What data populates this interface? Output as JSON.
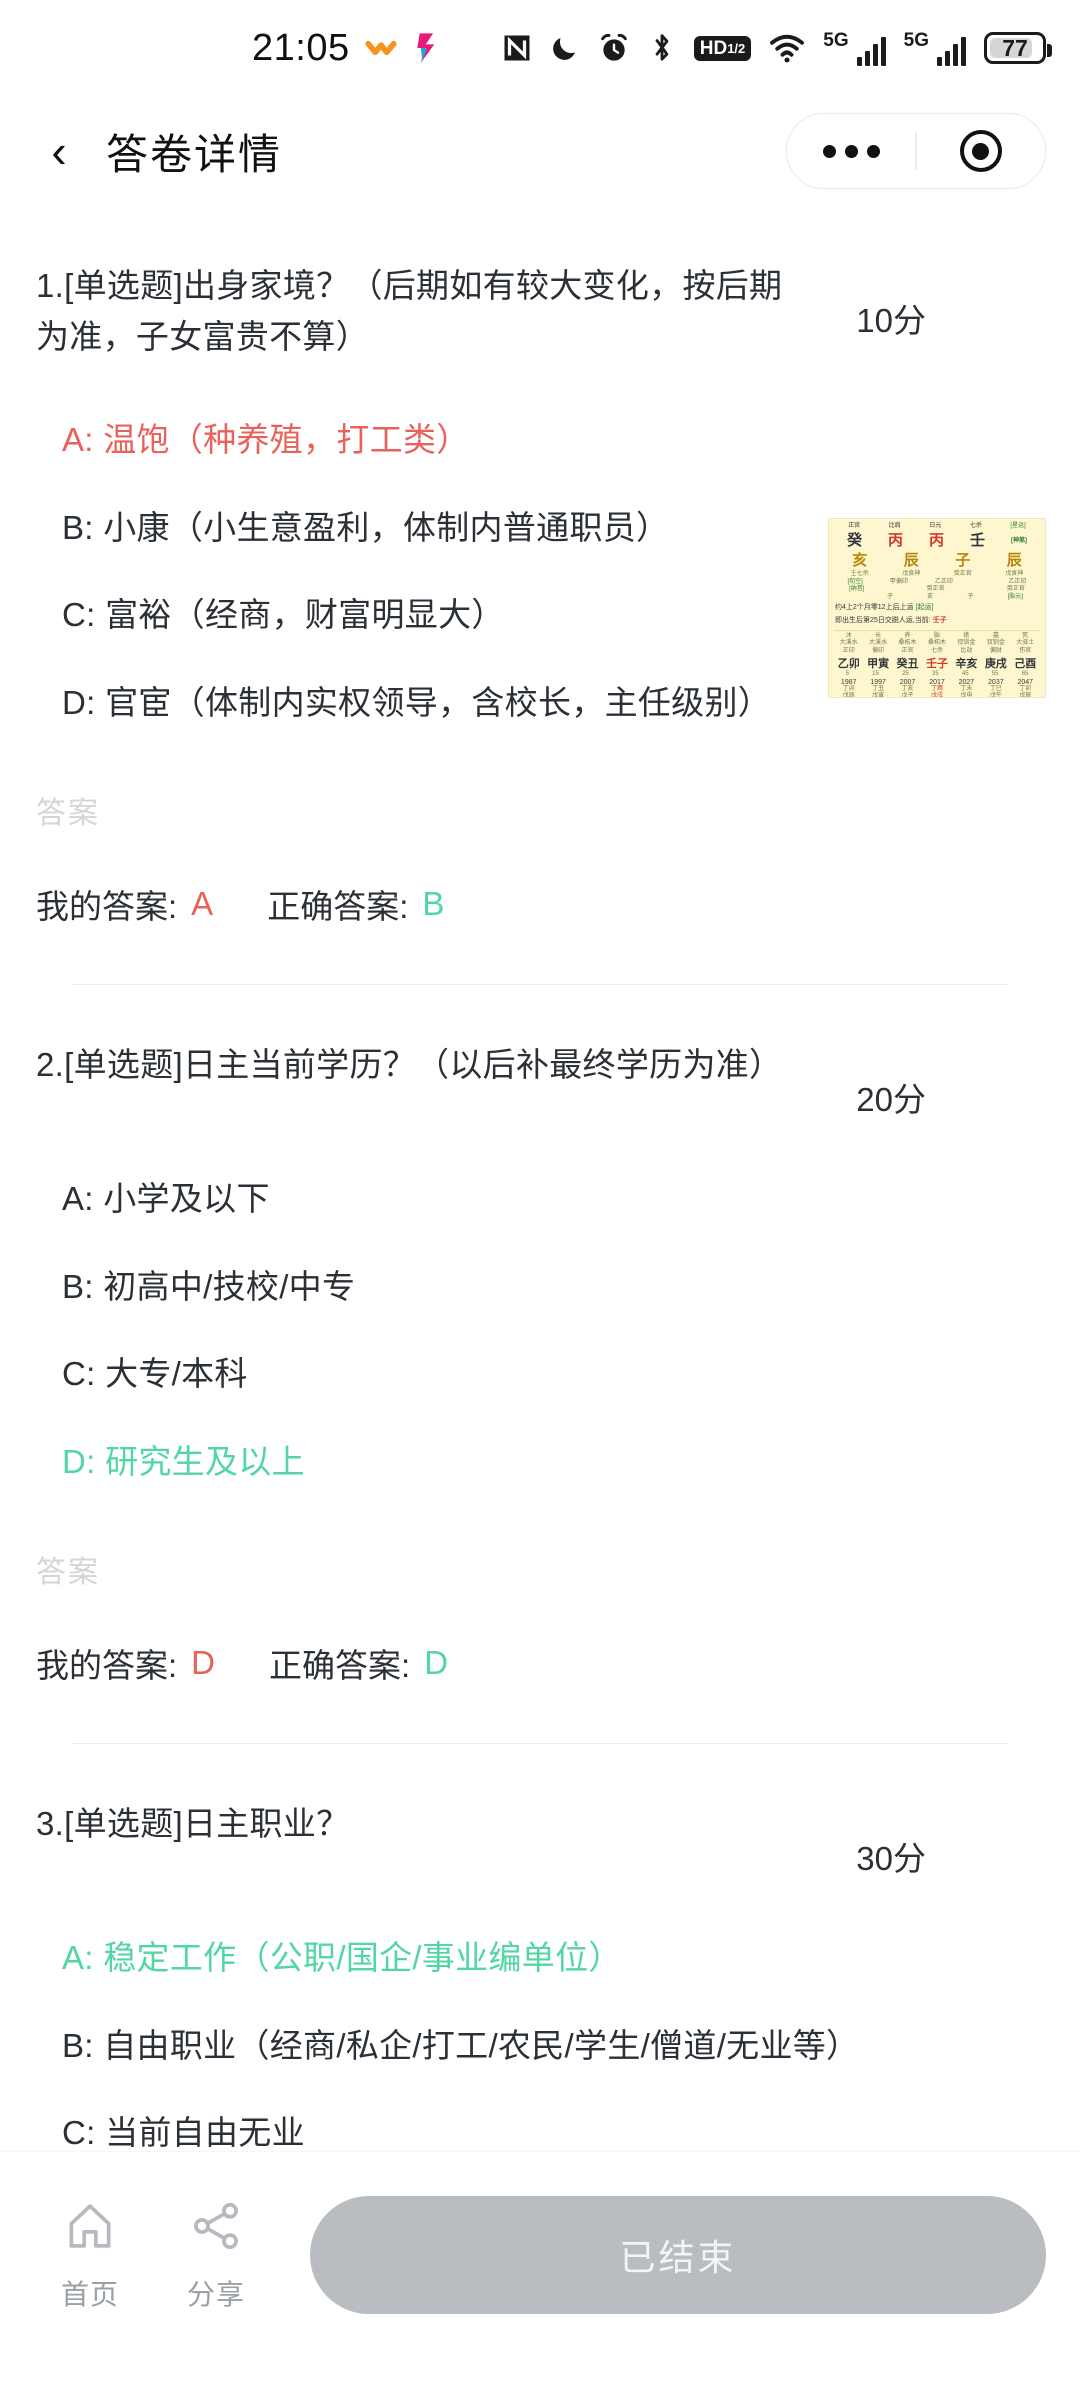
{
  "statusbar": {
    "time": "21:05",
    "app_icons": [
      "heart-orange-icon",
      "music-app-icon"
    ],
    "right_icons": [
      "nfc-icon",
      "do-not-disturb-moon-icon",
      "alarm-clock-icon",
      "bluetooth-icon",
      "hd-volte-icon",
      "wifi-icon"
    ],
    "network_1_label": "5G",
    "network_2_label": "5G",
    "battery_level": "77"
  },
  "header": {
    "back_icon": "chevron-left-icon",
    "title": "答卷详情",
    "capsule": {
      "more_icon": "more-dots-icon",
      "close_icon": "target-circle-icon"
    }
  },
  "answer_labels": {
    "section": "答案",
    "mine": "我的答案:",
    "correct": "正确答案:"
  },
  "questions": [
    {
      "title": "1.[单选题]出身家境？（后期如有较大变化，按后期为准，子女富贵不算）",
      "score": "10分",
      "options": [
        {
          "label": "A: 温饱（种养殖，打工类）",
          "state": "wrong"
        },
        {
          "label": "B: 小康（小生意盈利，体制内普通职员）",
          "state": "normal"
        },
        {
          "label": "C: 富裕（经商，财富明显大）",
          "state": "normal"
        },
        {
          "label": "D: 官宦（体制内实权领导，含校长，主任级别）",
          "state": "normal"
        }
      ],
      "my_answer": "A",
      "correct_answer": "B",
      "has_thumbnail": true
    },
    {
      "title": "2.[单选题]日主当前学历？（以后补最终学历为准）",
      "score": "20分",
      "options": [
        {
          "label": "A: 小学及以下",
          "state": "normal"
        },
        {
          "label": "B: 初高中/技校/中专",
          "state": "normal"
        },
        {
          "label": "C: 大专/本科",
          "state": "normal"
        },
        {
          "label": "D: 研究生及以上",
          "state": "correct"
        }
      ],
      "my_answer": "D",
      "correct_answer": "D",
      "has_thumbnail": false
    },
    {
      "title": "3.[单选题]日主职业？",
      "score": "30分",
      "options": [
        {
          "label": "A: 稳定工作（公职/国企/事业编单位）",
          "state": "correct"
        },
        {
          "label": "B: 自由职业（经商/私企/打工/农民/学生/僧道/无业等）",
          "state": "normal"
        },
        {
          "label": "C: 当前自由无业",
          "state": "normal"
        }
      ],
      "my_answer": "",
      "correct_answer": "",
      "has_thumbnail": false
    }
  ],
  "thumbnail": {
    "alt": "八字排盘缩略图",
    "header_row": [
      "正官",
      "比肩",
      "日元",
      "七杀",
      "star"
    ],
    "stems": [
      "癸",
      "丙",
      "丙",
      "壬"
    ],
    "branches": [
      "亥",
      "辰",
      "子",
      "辰"
    ],
    "sub1": [
      "壬甲",
      "戊乙癸",
      "癸",
      "戊乙癸"
    ],
    "note1": "约4上2个月零12上后上运",
    "note2": "即出生后第25日交脱人运,当前: 壬子",
    "gan_zhi": [
      "乙卯",
      "甲寅",
      "癸丑",
      "壬子",
      "辛亥",
      "庚戌",
      "己酉"
    ],
    "years": [
      "1987",
      "1997",
      "2007",
      "2017",
      "2027",
      "2037",
      "2047"
    ]
  },
  "bottombar": {
    "tabs": [
      {
        "icon": "home-icon",
        "label": "首页"
      },
      {
        "icon": "share-icon",
        "label": "分享"
      }
    ],
    "action_button": "已结束"
  },
  "colors": {
    "wrong": "#e8625b",
    "correct": "#52d6a3",
    "text": "#2b2f36",
    "muted": "#d3d5d8",
    "disabled_button": "#b9bcc0"
  }
}
